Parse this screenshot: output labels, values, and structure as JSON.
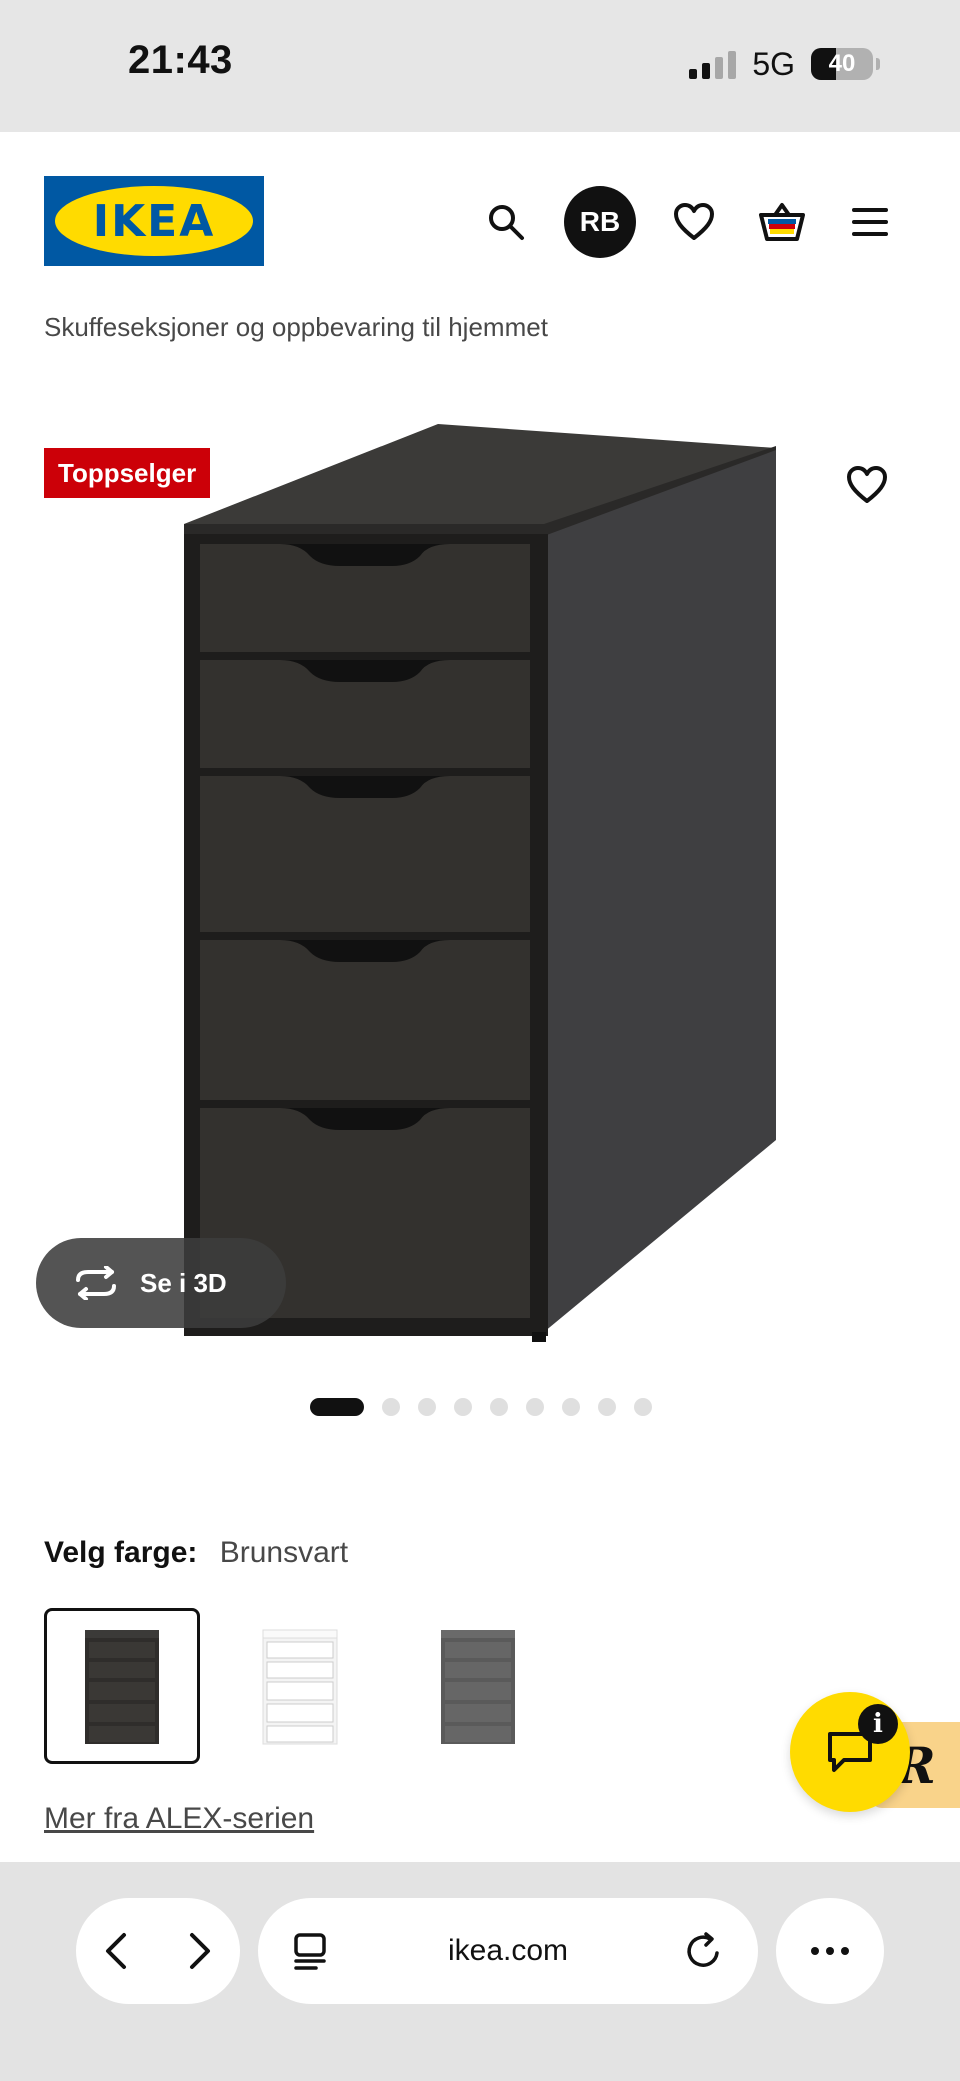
{
  "status_bar": {
    "time": "21:43",
    "network": "5G",
    "battery": "40"
  },
  "header": {
    "logo_text": "IKEA",
    "avatar_initials": "RB",
    "icons": [
      "search-icon",
      "avatar",
      "heart-icon",
      "basket-icon",
      "menu-icon"
    ],
    "brand_colors": {
      "blue": "#0058a3",
      "yellow": "#ffdb00"
    }
  },
  "breadcrumb": "Skuffeseksjoner og oppbevaring til hjemmet",
  "product": {
    "badge": "Toppselger",
    "badge_color": "#cc0008",
    "view_3d_label": "Se i 3D",
    "gallery": {
      "total": 9,
      "active": 1
    }
  },
  "color_selection": {
    "label": "Velg farge:",
    "selected_value": "Brunsvart",
    "swatches": [
      {
        "color": "#2f2d2b",
        "selected": true
      },
      {
        "color": "#f4f4f4",
        "selected": false
      },
      {
        "color": "#5a5a5a",
        "selected": false
      }
    ]
  },
  "series_link": "Mer fra ALEX-serien",
  "chat": {
    "info_badge": "i",
    "tab_letter": "R"
  },
  "browser": {
    "url": "ikea.com"
  }
}
